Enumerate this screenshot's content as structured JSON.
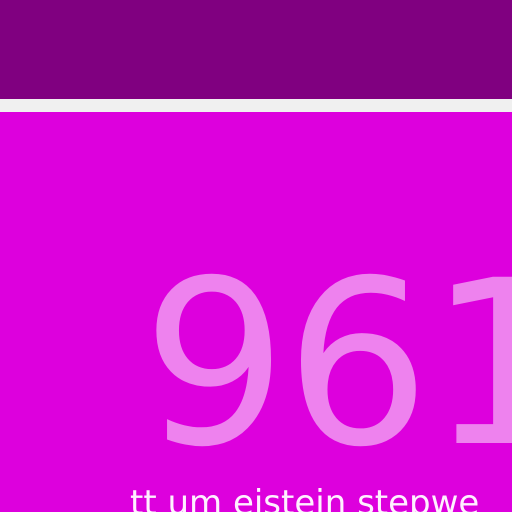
{
  "display": {
    "number": "961",
    "caption": "tt um eistein stepwe"
  },
  "colors": {
    "top_bar": "#800080",
    "divider": "#f0f0f0",
    "panel": "#dd00dd",
    "number": "#ee82ee",
    "caption": "#fff0ff"
  }
}
